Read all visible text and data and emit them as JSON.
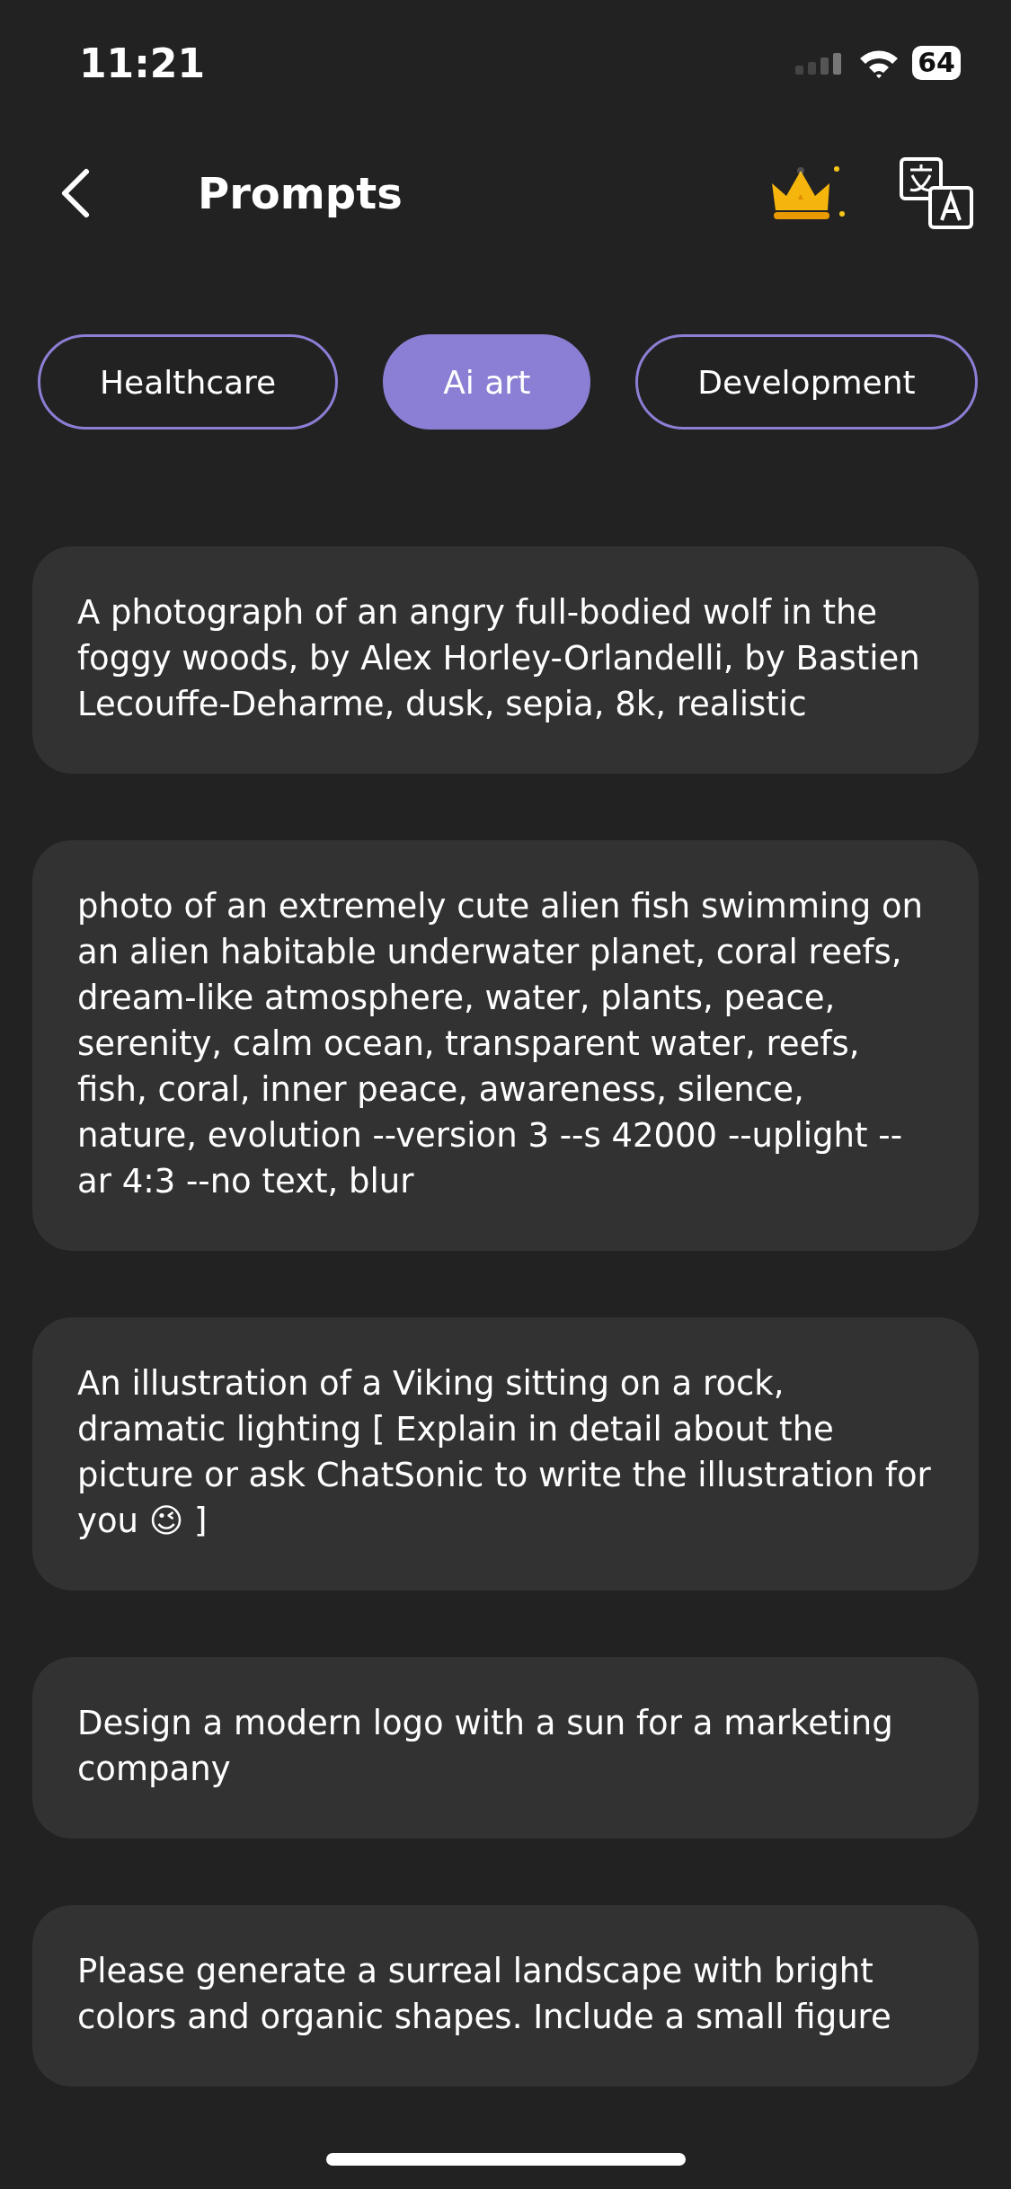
{
  "status_bar": {
    "time": "11:21",
    "battery": "64"
  },
  "header": {
    "title": "Prompts"
  },
  "tabs": [
    {
      "label": "Healthcare",
      "selected": false
    },
    {
      "label": "Ai art",
      "selected": true
    },
    {
      "label": "Development",
      "selected": false
    }
  ],
  "prompts": [
    {
      "text": "A photograph of an angry full-bodied wolf in the foggy woods, by Alex Horley-Orlandelli, by Bastien Lecouffe-Deharme, dusk, sepia, 8k, realistic"
    },
    {
      "text": "photo of an extremely cute alien fish swimming on an alien habitable underwater planet, coral reefs, dream-like atmosphere, water, plants, peace, serenity, calm ocean, transparent water, reefs, fish, coral, inner peace, awareness, silence, nature, evolution --version 3 --s 42000 --uplight --ar 4:3 --no text, blur"
    },
    {
      "text": "An illustration of a Viking sitting on a rock, dramatic lighting [ Explain in detail about the picture or ask ChatSonic to write the illustration for you 😉 ]"
    },
    {
      "text": "Design a modern logo with a sun for a marketing company"
    },
    {
      "text": "Please generate a surreal landscape with bright colors and organic shapes. Include a small figure"
    }
  ]
}
